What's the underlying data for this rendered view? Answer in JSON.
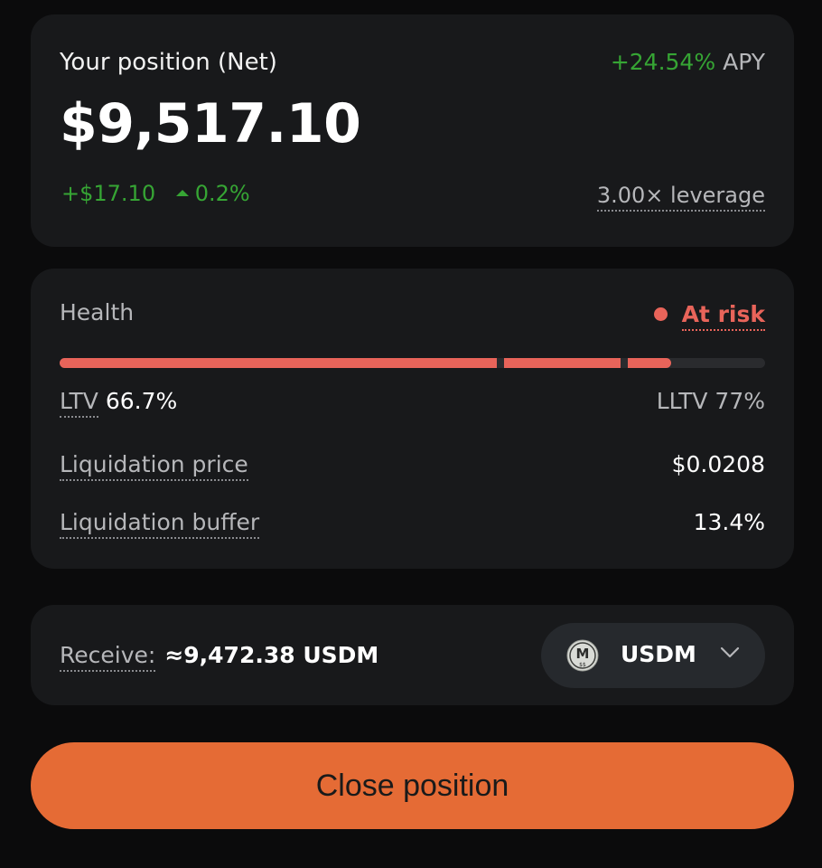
{
  "position": {
    "title": "Your position (Net)",
    "apy_value": "+24.54%",
    "apy_label": "APY",
    "net_value": "$9,517.10",
    "change_amount": "+$17.10",
    "change_percent": "0.2%",
    "leverage": "3.00× leverage"
  },
  "health": {
    "label": "Health",
    "status": "At risk",
    "ltv_label": "LTV",
    "ltv_value": "66.7%",
    "lltv": "LLTV 77%",
    "bar_fill_fraction": 0.867,
    "rows": [
      {
        "label": "Liquidation price",
        "value": "$0.0208"
      },
      {
        "label": "Liquidation buffer",
        "value": "13.4%"
      }
    ]
  },
  "receive": {
    "label": "Receive:",
    "amount": "≈9,472.38 USDM",
    "token": "USDM",
    "token_icon": "usdm-token-icon"
  },
  "actions": {
    "close_label": "Close position"
  },
  "colors": {
    "accent": "#e56b35",
    "positive": "#36a534",
    "risk": "#e8645a"
  }
}
